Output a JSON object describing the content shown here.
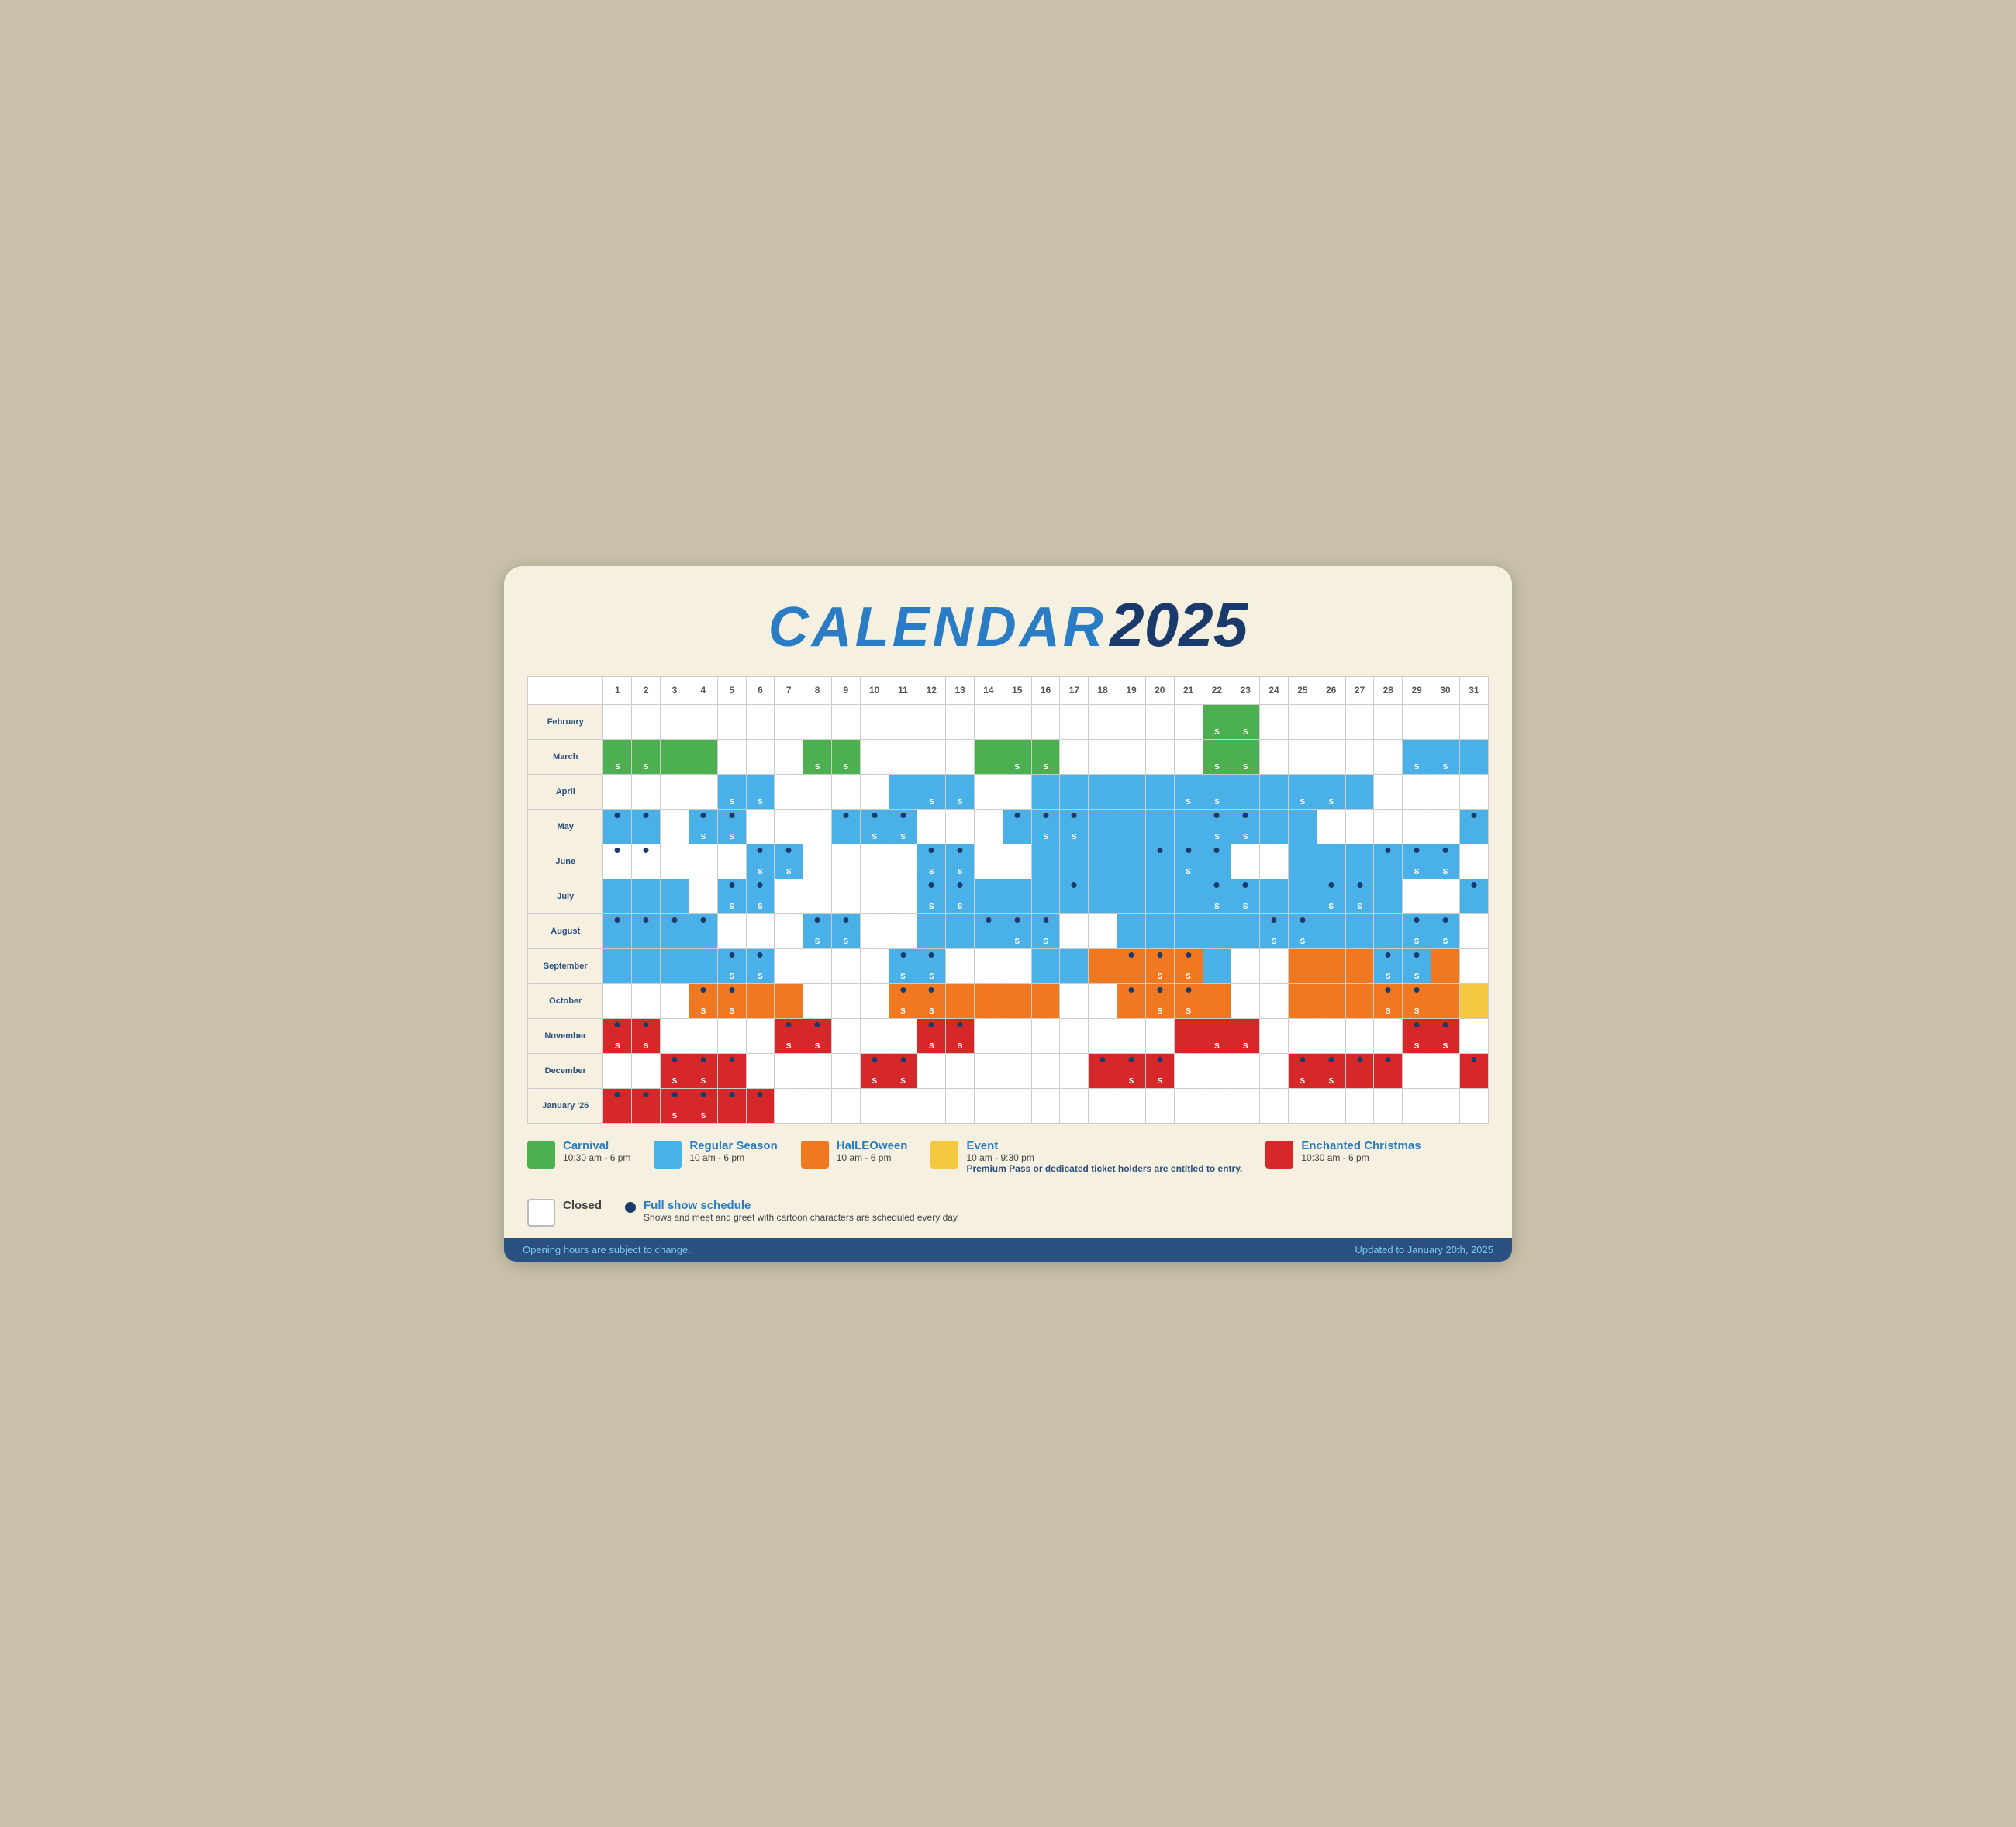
{
  "title": {
    "calendar": "CALENDAR",
    "year": "2025"
  },
  "days": [
    1,
    2,
    3,
    4,
    5,
    6,
    7,
    8,
    9,
    10,
    11,
    12,
    13,
    14,
    15,
    16,
    17,
    18,
    19,
    20,
    21,
    22,
    23,
    24,
    25,
    26,
    27,
    28,
    29,
    30,
    31
  ],
  "months": [
    {
      "name": "February",
      "cells": [
        "",
        "",
        "",
        "",
        "",
        "",
        "",
        "",
        "",
        "",
        "",
        "",
        "",
        "",
        "",
        "",
        "",
        "",
        "",
        "",
        "",
        "G-S",
        "G-S",
        "",
        "",
        "",
        "",
        "",
        "",
        "",
        ""
      ]
    },
    {
      "name": "March",
      "cells": [
        "G-S",
        "G-S",
        "G",
        "G",
        "",
        "",
        "",
        "G-S",
        "G-S",
        "",
        "",
        "",
        "",
        "G",
        "G-S",
        "G-S",
        "",
        "",
        "",
        "",
        "",
        "G-S",
        "G-S",
        "",
        "",
        "",
        "",
        "",
        "B-S",
        "B-S",
        "B"
      ]
    },
    {
      "name": "April",
      "cells": [
        "",
        "",
        "",
        "",
        "B-S",
        "B-S",
        "",
        "",
        "",
        "",
        "B",
        "B-S",
        "B-S",
        "",
        "",
        "B",
        "B",
        "B",
        "B",
        "B",
        "B-S",
        "B-S",
        "B",
        "B",
        "B-S",
        "B-S",
        "B",
        "",
        "",
        "",
        ""
      ]
    },
    {
      "name": "May",
      "cells": [
        "B-dot",
        "B-dot",
        "",
        "B-S-dot",
        "B-S-dot",
        "",
        "",
        "",
        "B-dot",
        "B-S-dot",
        "B-S-dot",
        "",
        "",
        "",
        "B-dot",
        "B-S-dot",
        "B-S-dot",
        "B",
        "B",
        "B",
        "B",
        "B-S-dot",
        "B-S-dot",
        "B",
        "B",
        "",
        "",
        "",
        "",
        "",
        "B-dot"
      ]
    },
    {
      "name": "June",
      "cells": [
        "dot-S",
        "dot",
        "",
        "",
        "",
        "B-S-dot",
        "B-S-dot",
        "",
        "",
        "",
        "",
        "B-dot-S",
        "B-dot-S",
        "",
        "",
        "B",
        "B",
        "B",
        "B",
        "B-dot",
        "B-S-dot",
        "B-dot",
        "",
        "",
        "B",
        "B",
        "B",
        "B-dot",
        "B-S-dot",
        "B-S-dot",
        ""
      ]
    },
    {
      "name": "July",
      "cells": [
        "B",
        "B",
        "B",
        "",
        "B-S-dot",
        "B-S-dot",
        "",
        "",
        "",
        "",
        "",
        "B-S-dot",
        "B-S-dot",
        "B",
        "B",
        "B",
        "B-dot",
        "B",
        "B",
        "B",
        "B",
        "B-S-dot",
        "B-S-dot",
        "B",
        "B",
        "B-S-dot",
        "B-S-dot",
        "B",
        "",
        "",
        "B-dot"
      ]
    },
    {
      "name": "August",
      "cells": [
        "B-dot",
        "B-dot",
        "B-dot",
        "B-dot",
        "",
        "",
        "",
        "B-S-dot",
        "B-S-dot",
        "",
        "",
        "B",
        "B",
        "B-dot",
        "B-S-dot",
        "B-S-dot",
        "",
        "",
        "B",
        "B",
        "B",
        "B",
        "B",
        "B-S-dot",
        "B-S-dot",
        "B",
        "B",
        "B",
        "B-S-dot",
        "B-S-dot",
        ""
      ]
    },
    {
      "name": "September",
      "cells": [
        "B",
        "B",
        "B",
        "B",
        "B-S-dot",
        "B-S-dot",
        "",
        "",
        "",
        "",
        "B-S-dot",
        "B-dot-S",
        "",
        "",
        "",
        "B",
        "B",
        "O",
        "O-dot",
        "O-S-dot",
        "O-S-dot",
        "B",
        "",
        "",
        "O",
        "O",
        "O",
        "B-S-dot",
        "B-S-dot",
        "O",
        ""
      ]
    },
    {
      "name": "October",
      "cells": [
        "",
        "",
        "",
        "O-S-dot",
        "O-S-dot",
        "O",
        "O",
        "",
        "",
        "",
        "O-S-dot",
        "O-S-dot",
        "O",
        "O",
        "O",
        "O",
        "",
        "",
        "O-dot",
        "O-S-dot",
        "O-S-dot",
        "O",
        "",
        "",
        "O",
        "O",
        "O",
        "O-S-dot",
        "O-S-dot",
        "O",
        "Y"
      ]
    },
    {
      "name": "November",
      "cells": [
        "R-dot-S",
        "R-dot-S",
        "",
        "",
        "",
        "",
        "R-S-dot",
        "R-S-dot",
        "",
        "",
        "",
        "R-S-dot",
        "R-S-dot",
        "",
        "",
        "",
        "",
        "",
        "",
        "",
        "R",
        "R-S",
        "R-S",
        "",
        "",
        "",
        "",
        "",
        "R-S-dot",
        "R-S-dot",
        ""
      ]
    },
    {
      "name": "December",
      "cells": [
        "",
        "",
        "R-S-dot",
        "R-S-dot",
        "R-dot",
        "",
        "",
        "",
        "",
        "R-S-dot",
        "R-S-dot",
        "",
        "",
        "",
        "",
        "",
        "",
        "R-dot",
        "R-S-dot",
        "R-S-dot",
        "",
        "",
        "",
        "",
        "R-S-dot",
        "R-S-dot",
        "R-dot",
        "R-dot",
        "",
        "",
        "R-dot"
      ]
    },
    {
      "name": "January '26",
      "cells": [
        "R-dot",
        "R-dot",
        "R-S-dot",
        "R-S-dot",
        "R-dot",
        "R-dot",
        "",
        "",
        "",
        "",
        "",
        "",
        "",
        "",
        "",
        "",
        "",
        "",
        "",
        "",
        "",
        "",
        "",
        "",
        "",
        "",
        "",
        "",
        "",
        "",
        ""
      ]
    }
  ],
  "legend": {
    "carnival": {
      "color": "#4caf50",
      "label": "Carnival",
      "hours": "10:30 am - 6 pm"
    },
    "regular": {
      "color": "#4ab0e8",
      "label": "Regular Season",
      "hours": "10 am - 6 pm"
    },
    "halloween": {
      "color": "#f07820",
      "label": "HalLEOween",
      "hours": "10 am - 6 pm"
    },
    "event": {
      "color": "#f5c842",
      "label": "Event",
      "hours": "10 am - 9:30 pm",
      "note": "Premium Pass or dedicated ticket holders are entitled to entry."
    },
    "christmas": {
      "color": "#d62828",
      "label": "Enchanted Christmas",
      "hours": "10:30 am - 6 pm"
    },
    "closed": {
      "label": "Closed"
    },
    "show": {
      "label": "Full show schedule",
      "note": "Shows and  meet and greet with cartoon characters are scheduled every day."
    }
  },
  "footer": {
    "left": "Opening hours are subject to change.",
    "right": "Updated to January 20th, 2025"
  }
}
